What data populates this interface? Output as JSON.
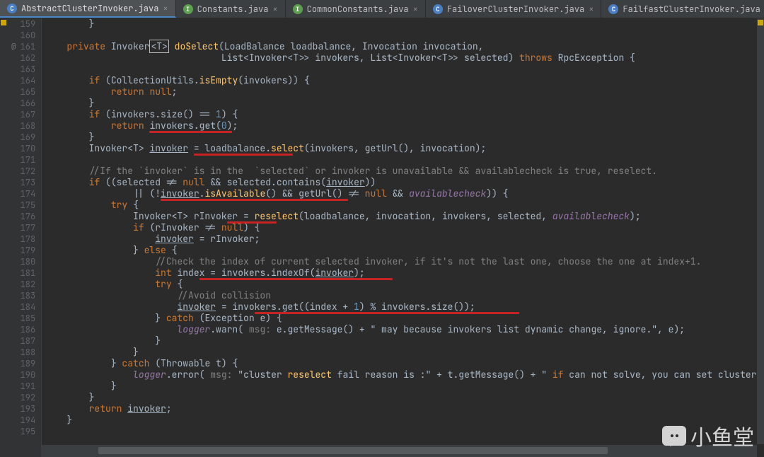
{
  "tabs": [
    {
      "label": "AbstractClusterInvoker.java",
      "iconClass": "ico-class",
      "iconLetter": "C",
      "active": true
    },
    {
      "label": "Constants.java",
      "iconClass": "ico-interface",
      "iconLetter": "I",
      "active": false
    },
    {
      "label": "CommonConstants.java",
      "iconClass": "ico-interface",
      "iconLetter": "I",
      "active": false
    },
    {
      "label": "FailoverClusterInvoker.java",
      "iconClass": "ico-class",
      "iconLetter": "C",
      "active": false
    },
    {
      "label": "FailfastClusterInvoker.java",
      "iconClass": "ico-class",
      "iconLetter": "C",
      "active": false
    }
  ],
  "line_start": 159,
  "line_end": 195,
  "override_line": 161,
  "watermark": "小鱼堂",
  "code_lines": {
    "159": "        }",
    "160": "",
    "161": "    private Invoker<T> doSelect(LoadBalance loadbalance, Invocation invocation,",
    "162": "                                List<Invoker<T>> invokers, List<Invoker<T>> selected) throws RpcException {",
    "163": "",
    "164": "        if (CollectionUtils.isEmpty(invokers)) {",
    "165": "            return null;",
    "166": "        }",
    "167": "        if (invokers.size() == 1) {",
    "168": "            return invokers.get(0);",
    "169": "        }",
    "170": "        Invoker<T> invoker = loadbalance.select(invokers, getUrl(), invocation);",
    "171": "",
    "172": "        //If the `invoker` is in the  `selected` or invoker is unavailable && availablecheck is true, reselect.",
    "173": "        if ((selected != null && selected.contains(invoker))",
    "174": "                || (!invoker.isAvailable() && getUrl() != null && availablecheck)) {",
    "175": "            try {",
    "176": "                Invoker<T> rInvoker = reselect(loadbalance, invocation, invokers, selected, availablecheck);",
    "177": "                if (rInvoker != null) {",
    "178": "                    invoker = rInvoker;",
    "179": "                } else {",
    "180": "                    //Check the index of current selected invoker, if it's not the last one, choose the one at index+1.",
    "181": "                    int index = invokers.indexOf(invoker);",
    "182": "                    try {",
    "183": "                        //Avoid collision",
    "184": "                        invoker = invokers.get((index + 1) % invokers.size());",
    "185": "                    } catch (Exception e) {",
    "186": "                        logger.warn( msg: e.getMessage() + \" may because invokers list dynamic change, ignore.\", e);",
    "187": "                    }",
    "188": "                }",
    "189": "            } catch (Throwable t) {",
    "190": "                logger.error( msg: \"cluster reselect fail reason is :\" + t.getMessage() + \" if can not solve, you can set cluster",
    "191": "            }",
    "192": "        }",
    "193": "        return invoker;",
    "194": "    }",
    "195": ""
  },
  "red_underlines": [
    {
      "line": 168,
      "col_ch": 19,
      "len_ch": 15
    },
    {
      "line": 170,
      "col_ch": 27,
      "len_ch": 18
    },
    {
      "line": 174,
      "col_ch": 21,
      "len_ch": 34
    },
    {
      "line": 176,
      "col_ch": 33,
      "len_ch": 9
    },
    {
      "line": 181,
      "col_ch": 28,
      "len_ch": 35
    },
    {
      "line": 184,
      "col_ch": 38,
      "len_ch": 48
    }
  ],
  "accent": {
    "keyword": "#cc7832",
    "method": "#ffc66d",
    "field": "#9876aa",
    "number": "#6897bb",
    "string": "#6a8759",
    "comment": "#808080",
    "red": "#c62424"
  }
}
